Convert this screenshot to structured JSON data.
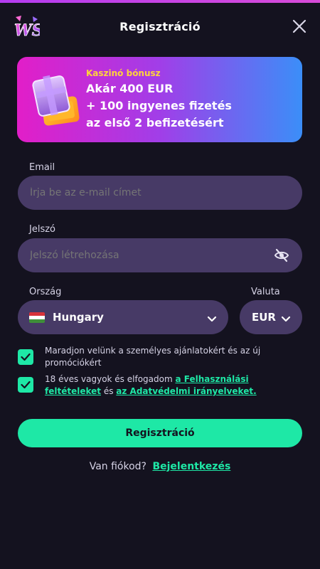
{
  "header": {
    "title": "Regisztráció",
    "logo_text": "WS"
  },
  "banner": {
    "label": "Kaszinó bónusz",
    "line1": "Akár 400 EUR",
    "line2": "+ 100 ingyenes fizetés",
    "line3": "az első 2 befizetésért"
  },
  "form": {
    "email": {
      "label": "Email",
      "placeholder": "Írja be az e-mail címet"
    },
    "password": {
      "label": "Jelszó",
      "placeholder": "Jelszó létrehozása"
    },
    "country": {
      "label": "Ország",
      "value": "Hungary"
    },
    "currency": {
      "label": "Valuta",
      "value": "EUR"
    },
    "consent_offers": {
      "checked": true,
      "text": "Maradjon velünk a személyes ajánlatokért és az új promóciókért"
    },
    "consent_terms": {
      "checked": true,
      "text_before": "18 éves vagyok és elfogadom ",
      "terms_link": "a Felhasználási feltételeket",
      "text_middle": " és ",
      "privacy_link": "az Adatvédelmi irányelveket."
    },
    "submit_label": "Regisztráció"
  },
  "login": {
    "prompt": "Van fiókod?",
    "link": "Bejelentkezés"
  },
  "colors": {
    "background": "#14121f",
    "input": "#473a66",
    "accent": "#1ee8a6",
    "bonus_label": "#ffd43a"
  },
  "icons": {
    "logo": "ws-logo-icon",
    "close": "close-icon",
    "gift": "gift-box-icon",
    "eye": "eye-off-icon",
    "chevron": "chevron-down-icon",
    "check": "check-icon",
    "flag": "hungary-flag-icon"
  }
}
